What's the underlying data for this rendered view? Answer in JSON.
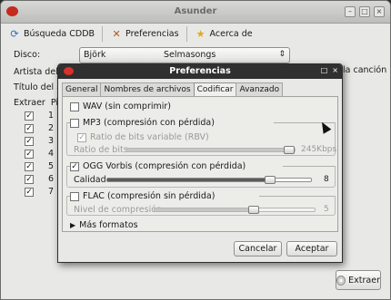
{
  "main_window": {
    "title": "Asunder",
    "toolbar": {
      "cddb_label": "Búsqueda CDDB",
      "prefs_label": "Preferencias",
      "about_label": "Acerca de"
    },
    "disc_label": "Disco:",
    "disc_artist": "Björk",
    "disc_title": "Selmasongs",
    "artist_label": "Artista del á",
    "album_title_label": "Título del ál",
    "side_text": "la canción",
    "table_headers": {
      "extract": "Extraer",
      "track": "Pis"
    },
    "tracks": [
      "1",
      "2",
      "3",
      "4",
      "5",
      "6",
      "7"
    ],
    "extract_button": "Extraer"
  },
  "dialog": {
    "title": "Preferencias",
    "tabs": [
      "General",
      "Nombres de archivos",
      "Codificar",
      "Avanzado"
    ],
    "active_tab": "Codificar",
    "wav_label": "WAV (sin comprimir)",
    "mp3_label": "MP3 (compresión con pérdida)",
    "mp3_vbr_label": "Ratio de bits variable (RBV)",
    "mp3_bitrate_label": "Ratio de bits",
    "mp3_bitrate_value": "245Kbps",
    "mp3_bitrate_level": 0.97,
    "ogg_label": "OGG Vorbis (compresión con pérdida)",
    "ogg_quality_label": "Calidad",
    "ogg_quality_value": "8",
    "ogg_quality_level": 0.8,
    "flac_label": "FLAC (compresión sin pérdida)",
    "flac_level_label": "Nivel de compresión",
    "flac_level_value": "5",
    "flac_level_level": 0.62,
    "more_formats_label": "Más formatos",
    "cancel_button": "Cancelar",
    "accept_button": "Aceptar"
  },
  "colors": {
    "dialog_titlebar": "#303030",
    "window_bg": "#e8e8e6",
    "app_logo_red": "#c52a1f"
  }
}
